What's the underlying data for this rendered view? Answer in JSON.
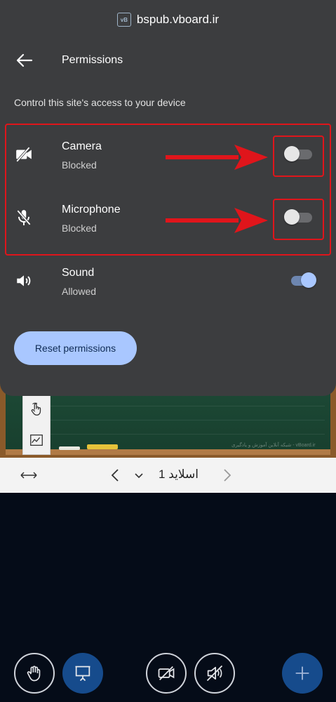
{
  "site": {
    "url": "bspub.vboard.ir",
    "icon_text": "vB"
  },
  "header": {
    "title": "Permissions"
  },
  "subtitle": "Control this site's access to your device",
  "permissions": [
    {
      "name": "Camera",
      "status": "Blocked",
      "enabled": false,
      "icon": "camera-off-icon"
    },
    {
      "name": "Microphone",
      "status": "Blocked",
      "enabled": false,
      "icon": "mic-off-icon"
    },
    {
      "name": "Sound",
      "status": "Allowed",
      "enabled": true,
      "icon": "volume-icon"
    }
  ],
  "reset_label": "Reset permissions",
  "slide_bar": {
    "label": "اسلاید 1"
  },
  "board": {
    "watermark": "vBoard.ir - شبکه آنلاین آموزش و یادگیری"
  },
  "colors": {
    "sheet_bg": "#3c3d3f",
    "accent": "#a9c7ff",
    "annotation_red": "#e0151b",
    "app_bg": "#050c18",
    "board_green": "#1d4a36",
    "primary_blue": "#164b8c"
  }
}
